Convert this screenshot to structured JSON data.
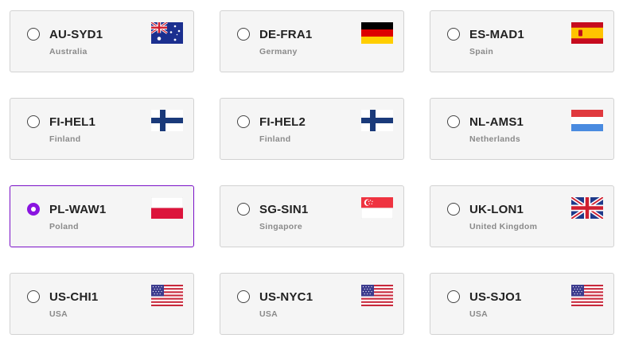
{
  "regions": [
    {
      "code": "AU-SYD1",
      "country": "Australia",
      "flag": "australia-flag-icon",
      "selected": false
    },
    {
      "code": "DE-FRA1",
      "country": "Germany",
      "flag": "germany-flag-icon",
      "selected": false
    },
    {
      "code": "ES-MAD1",
      "country": "Spain",
      "flag": "spain-flag-icon",
      "selected": false
    },
    {
      "code": "FI-HEL1",
      "country": "Finland",
      "flag": "finland-flag-icon",
      "selected": false
    },
    {
      "code": "FI-HEL2",
      "country": "Finland",
      "flag": "finland-flag-icon",
      "selected": false
    },
    {
      "code": "NL-AMS1",
      "country": "Netherlands",
      "flag": "netherlands-flag-icon",
      "selected": false
    },
    {
      "code": "PL-WAW1",
      "country": "Poland",
      "flag": "poland-flag-icon",
      "selected": true
    },
    {
      "code": "SG-SIN1",
      "country": "Singapore",
      "flag": "singapore-flag-icon",
      "selected": false
    },
    {
      "code": "UK-LON1",
      "country": "United Kingdom",
      "flag": "uk-flag-icon",
      "selected": false
    },
    {
      "code": "US-CHI1",
      "country": "USA",
      "flag": "usa-flag-icon",
      "selected": false
    },
    {
      "code": "US-NYC1",
      "country": "USA",
      "flag": "usa-flag-icon",
      "selected": false
    },
    {
      "code": "US-SJO1",
      "country": "USA",
      "flag": "usa-flag-icon",
      "selected": false
    }
  ],
  "colors": {
    "selected_accent": "#8a14e0",
    "card_background": "#f5f5f5",
    "card_border": "#d2d2d2"
  }
}
